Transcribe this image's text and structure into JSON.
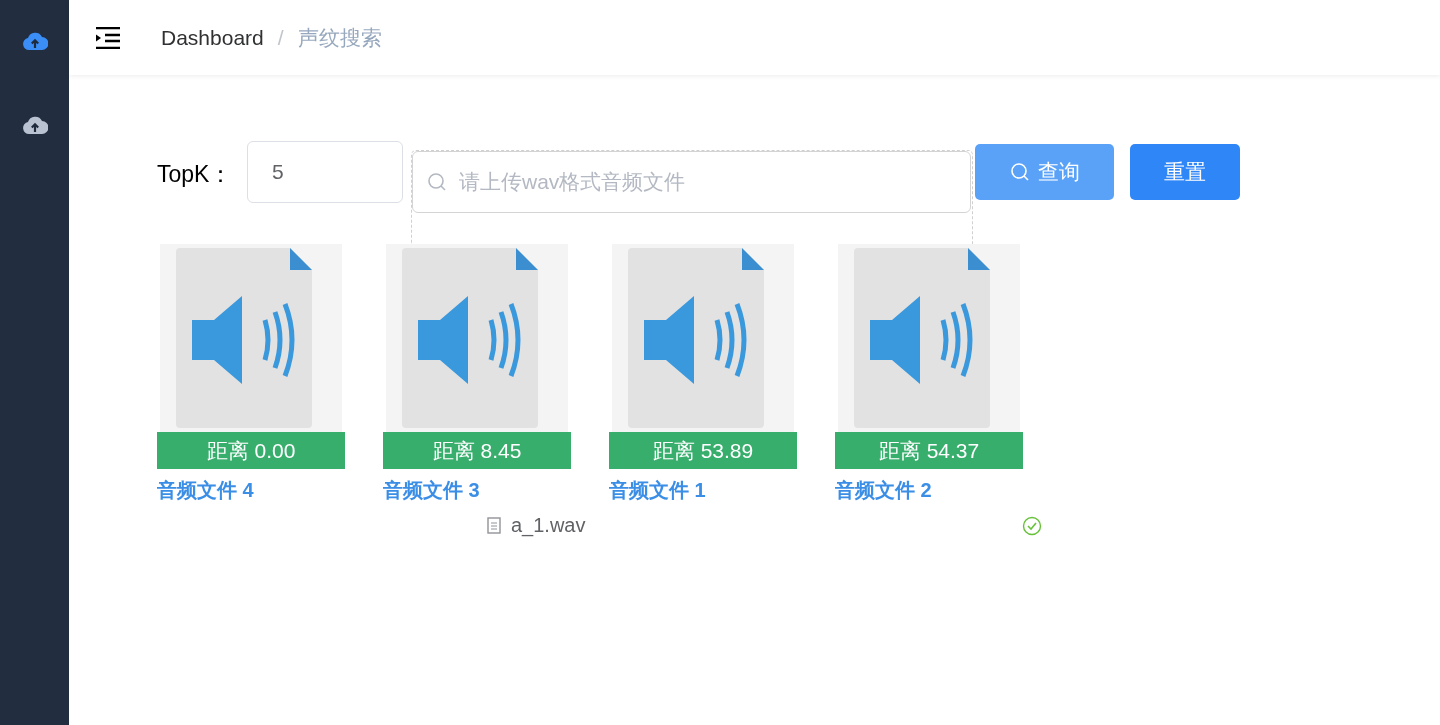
{
  "sidebar": {
    "items": [
      {
        "selected": true
      },
      {
        "selected": false
      }
    ]
  },
  "header": {
    "breadcrumb": [
      "Dashboard",
      "声纹搜索"
    ],
    "separator": "/"
  },
  "search": {
    "topk_label": "TopK：",
    "topk_value": "5",
    "upload_placeholder": "请上传wav格式音频文件",
    "buttons": [
      {
        "label": "查询",
        "kind": "light"
      },
      {
        "label": "重置",
        "kind": "primary"
      }
    ],
    "file": {
      "name": "a_1.wav",
      "done": true
    }
  },
  "results": [
    {
      "distance": "距离 0.00",
      "name": "音频文件 4"
    },
    {
      "distance": "距离 8.45",
      "name": "音频文件 3"
    },
    {
      "distance": "距离 53.89",
      "name": "音频文件 1"
    },
    {
      "distance": "距离 54.37",
      "name": "音频文件 2"
    }
  ]
}
